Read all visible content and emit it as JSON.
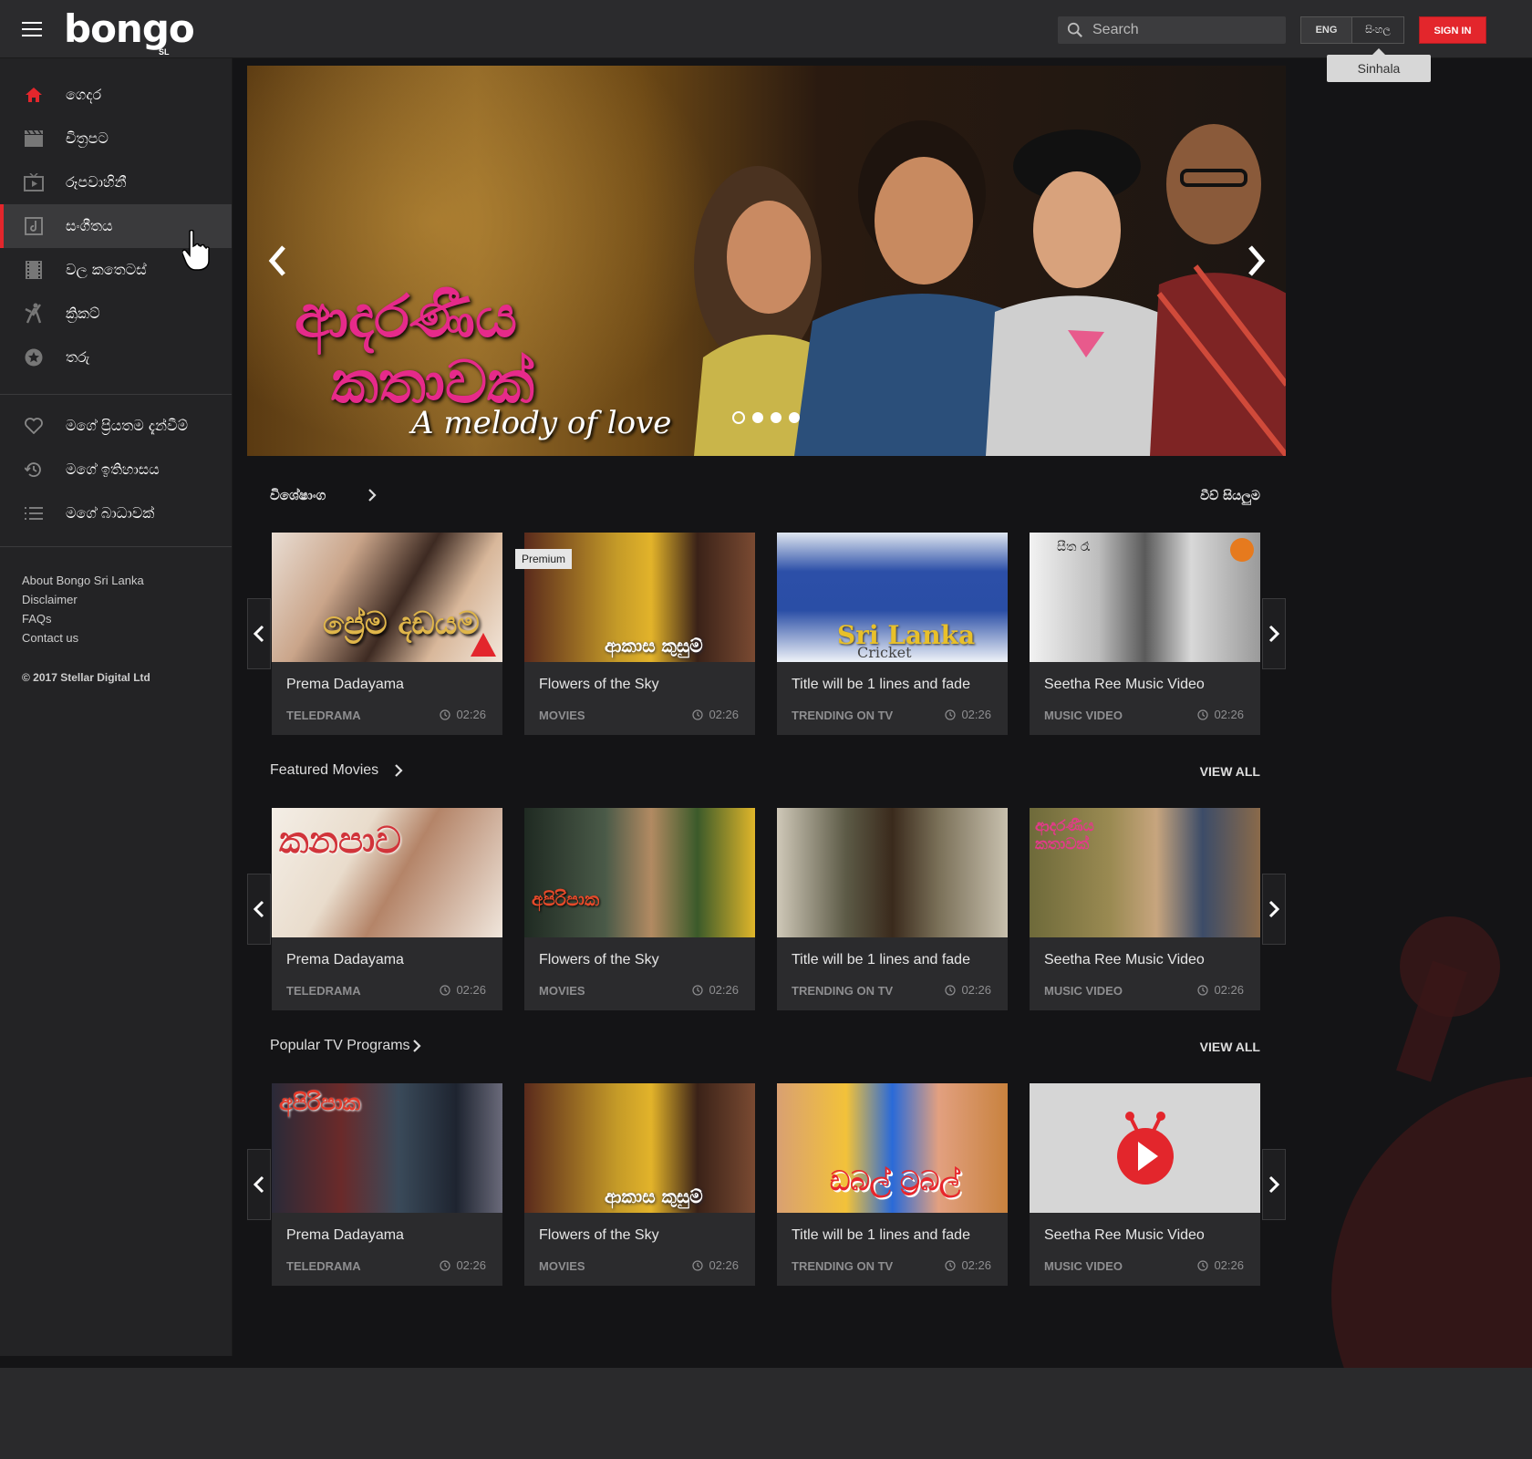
{
  "header": {
    "logo_text": "bongo",
    "logo_sub": "SL",
    "search_placeholder": "Search",
    "lang_eng": "ENG",
    "lang_si": "සිංහල",
    "tooltip": "Sinhala",
    "signin": "SIGN IN"
  },
  "sidebar": {
    "items": [
      {
        "label": "ගෙදර",
        "icon": "home-icon"
      },
      {
        "label": "චිත්‍රපට",
        "icon": "clapperboard-icon"
      },
      {
        "label": "රූපවාහිනී",
        "icon": "tv-icon"
      },
      {
        "label": "සංගීතය",
        "icon": "music-icon"
      },
      {
        "label": "වල කතෙටස්",
        "icon": "film-strip-icon"
      },
      {
        "label": "ක්‍රිකට්",
        "icon": "cricket-icon"
      },
      {
        "label": "තරු",
        "icon": "star-icon"
      }
    ],
    "personal": [
      {
        "label": "මගේ ප්‍රියතම දැන්වීම්",
        "icon": "heart-icon"
      },
      {
        "label": "මගේ ඉතිහාසය",
        "icon": "history-icon"
      },
      {
        "label": "මගේ බාධාවක්",
        "icon": "list-icon"
      }
    ],
    "links": [
      "About Bongo Sri Lanka",
      "Disclaimer",
      "FAQs",
      "Contact us"
    ],
    "copyright": "© 2017 Stellar Digital Ltd"
  },
  "hero": {
    "title_line1": "ආදරණීය",
    "title_line2": "කතාවක්",
    "subtitle": "A melody of love",
    "slides": 4,
    "active_slide": 1
  },
  "sections": [
    {
      "title": "විශේෂාංග",
      "view_all": "වීව් සියලුම",
      "cards": [
        {
          "title": "Prema Dadayama",
          "category": "TELEDRAMA",
          "duration": "02:26",
          "thumb_text": "ප්‍රේම දඩයම"
        },
        {
          "title": "Flowers of the Sky",
          "category": "MOVIES",
          "duration": "02:26",
          "badge": "Premium",
          "thumb_text": "ආකාස කුසුම්"
        },
        {
          "title": "Title will be 1 lines and fade",
          "category": "TRENDING ON TV",
          "duration": "02:26",
          "thumb_text": "Sri Lanka",
          "thumb_sub": "Cricket"
        },
        {
          "title": "Seetha Ree Music Video",
          "category": "MUSIC VIDEO",
          "duration": "02:26",
          "thumb_text": "සීත රෑ"
        }
      ]
    },
    {
      "title": "Featured Movies",
      "view_all": "VIEW ALL",
      "cards": [
        {
          "title": "Prema Dadayama",
          "category": "TELEDRAMA",
          "duration": "02:26",
          "thumb_text": "කනපාව"
        },
        {
          "title": "Flowers of the Sky",
          "category": "MOVIES",
          "duration": "02:26",
          "thumb_text": "අපිරිපාක"
        },
        {
          "title": "Title will be 1 lines and fade",
          "category": "TRENDING ON TV",
          "duration": "02:26",
          "thumb_text": ""
        },
        {
          "title": "Seetha Ree Music Video",
          "category": "MUSIC VIDEO",
          "duration": "02:26",
          "thumb_text": "ආදරණීය කතාවක්"
        }
      ]
    },
    {
      "title": "Popular TV Programs",
      "view_all": "VIEW ALL",
      "cards": [
        {
          "title": "Prema Dadayama",
          "category": "TELEDRAMA",
          "duration": "02:26",
          "thumb_text": "අපිරිපාක"
        },
        {
          "title": "Flowers of the Sky",
          "category": "MOVIES",
          "duration": "02:26",
          "thumb_text": "ආකාස කුසුම්"
        },
        {
          "title": "Title will be 1 lines and fade",
          "category": "TRENDING ON TV",
          "duration": "02:26",
          "thumb_text": "ඩබල් ට්‍රබල්"
        },
        {
          "title": "Seetha Ree Music Video",
          "category": "MUSIC VIDEO",
          "duration": "02:26",
          "thumb_text": ""
        }
      ]
    }
  ],
  "colors": {
    "accent": "#e3262c",
    "sidebar": "#232325",
    "card": "#2b2b2d"
  }
}
